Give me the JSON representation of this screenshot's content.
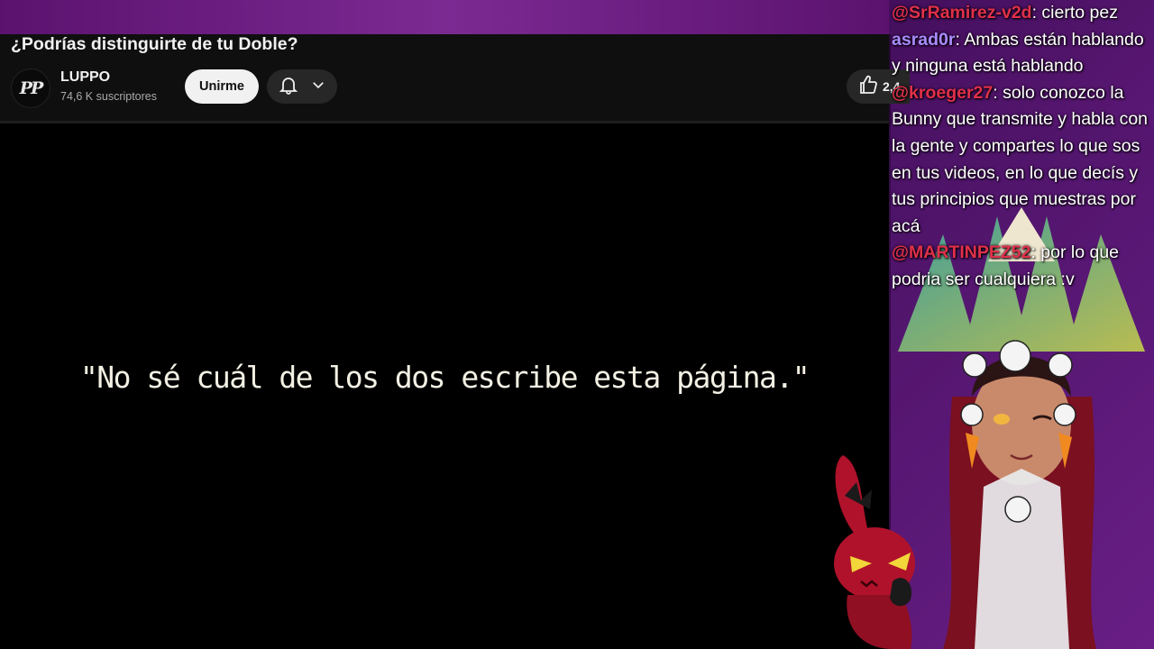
{
  "video": {
    "title": "¿Podrías distinguirte de tu Doble?",
    "quote": "\"No sé cuál de los dos escribe esta página.\""
  },
  "channel": {
    "avatar_text": "PP",
    "name": "LUPPO",
    "subscribers": "74,6 K suscriptores",
    "join_label": "Unirme",
    "like_count": "2,4"
  },
  "icons": {
    "bell": "bell-icon",
    "chevron": "chevron-down-icon",
    "like": "thumbs-up-icon"
  },
  "chat": [
    {
      "user": "@SrRamirez-v2d",
      "color": "#e0304a",
      "text": ": cierto pez"
    },
    {
      "user": "asrad0r",
      "color": "#a98cff",
      "text": ": Ambas están hablando y ninguna está hablando"
    },
    {
      "user": "@kroeger27",
      "color": "#e0304a",
      "text": ": solo conozco la Bunny que transmite y habla con la gente y compartes lo que sos en tus videos, en lo que decís y tus principios que muestras por acá"
    },
    {
      "user": "@MARTINPEZ52",
      "color": "#e0304a",
      "text": ": por lo que podria ser cualquiera :v"
    }
  ],
  "colors": {
    "stream_bg": "#5a0f6e",
    "yt_bg": "#0f0f0f",
    "mention": "#e0304a",
    "username_alt": "#a98cff"
  }
}
